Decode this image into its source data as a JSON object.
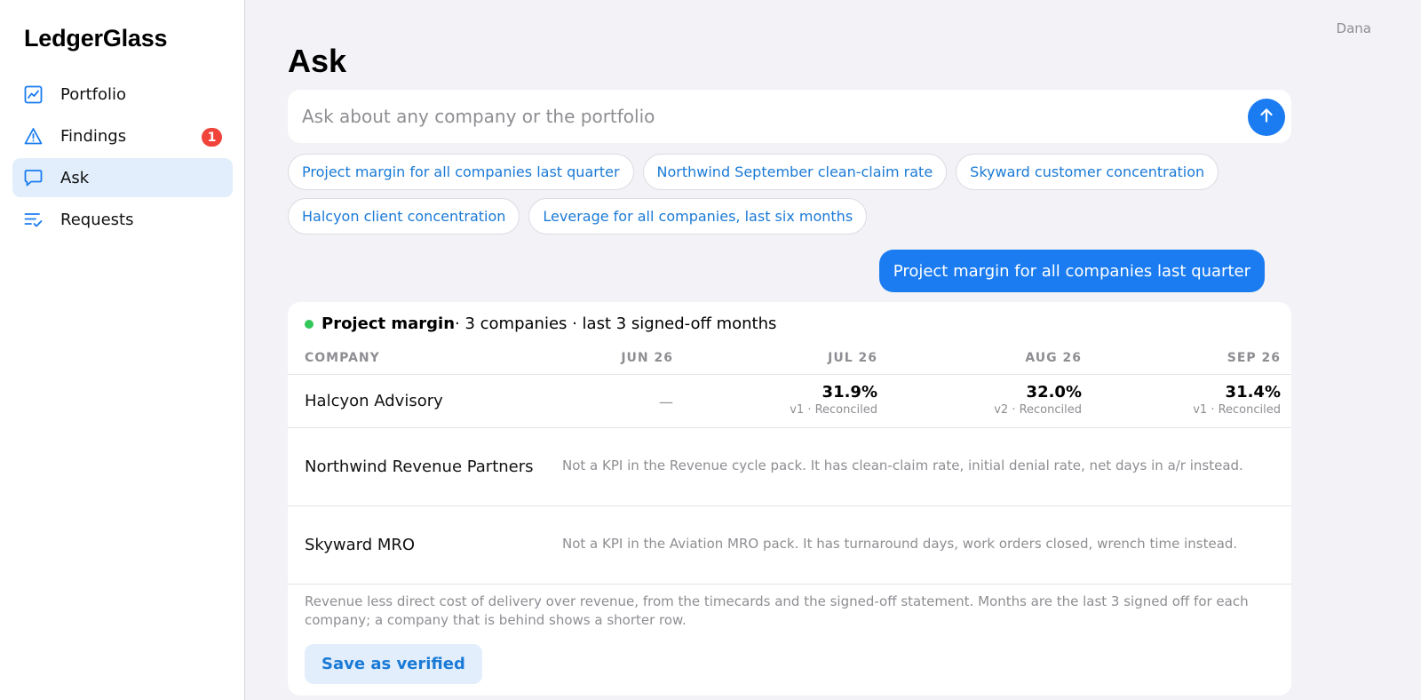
{
  "app": {
    "name": "LedgerGlass"
  },
  "sidebar": {
    "items": [
      {
        "label": "Portfolio",
        "icon": "chart-line-icon",
        "active": false
      },
      {
        "label": "Findings",
        "icon": "warning-triangle-icon",
        "badge": "1",
        "active": false
      },
      {
        "label": "Ask",
        "icon": "chat-bubble-icon",
        "active": true
      },
      {
        "label": "Requests",
        "icon": "list-check-icon",
        "active": false
      }
    ]
  },
  "header": {
    "user": "Dana"
  },
  "page": {
    "title": "Ask"
  },
  "search": {
    "placeholder": "Ask about any company or the portfolio",
    "value": ""
  },
  "suggestions": [
    "Project margin for all companies last quarter",
    "Northwind September clean-claim rate",
    "Skyward customer concentration",
    "Halcyon client concentration",
    "Leverage for all companies, last six months"
  ],
  "query_bubble": "Project margin for all companies last quarter",
  "result": {
    "metric": "Project margin",
    "summary": " · 3 companies · last 3 signed-off months",
    "status_color": "#34c759",
    "columns": [
      "COMPANY",
      "JUN 26",
      "JUL 26",
      "AUG 26",
      "SEP 26"
    ],
    "rows": [
      {
        "company": "Halcyon Advisory",
        "jun": "—",
        "cells": [
          {
            "value": "31.9%",
            "meta": "v1 · Reconciled"
          },
          {
            "value": "32.0%",
            "meta": "v2 · Reconciled"
          },
          {
            "value": "31.4%",
            "meta": "v1 · Reconciled"
          }
        ]
      },
      {
        "company": "Northwind Revenue Partners",
        "note": "Not a KPI in the Revenue cycle pack. It has clean-claim rate, initial denial rate, net days in a/r instead."
      },
      {
        "company": "Skyward MRO",
        "note": "Not a KPI in the Aviation MRO pack. It has turnaround days, work orders closed, wrench time instead."
      }
    ],
    "footnote": "Revenue less direct cost of delivery over revenue, from the timecards and the signed-off statement. Months are the last 3 signed off for each company; a company that is behind shows a shorter row.",
    "save_label": "Save as verified"
  },
  "colors": {
    "accent": "#1a7cf0",
    "badge": "#f0433a",
    "active_nav": "#e2eefc"
  }
}
